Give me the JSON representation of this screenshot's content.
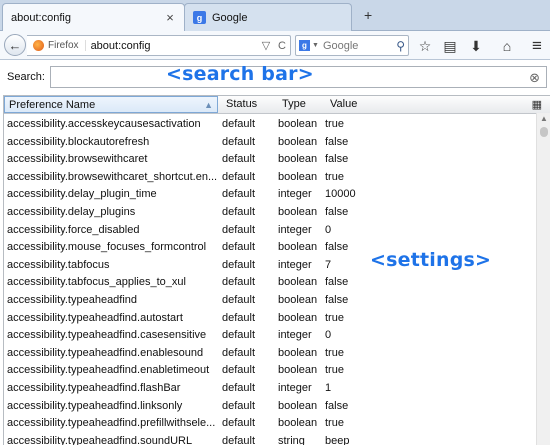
{
  "tabs": [
    {
      "title": "about:config"
    },
    {
      "title": "Google",
      "favicon": "g"
    }
  ],
  "new_tab_icon": "+",
  "navbar": {
    "back_icon": "←",
    "identity_label": "Firefox",
    "url": "about:config",
    "dropdown_icon": "▽",
    "reload_icon": "C",
    "search_engine_icon": "g",
    "search_placeholder": "Google",
    "search_icon": "⚲",
    "star_icon": "☆",
    "bookmarks_icon": "▤",
    "download_icon": "⬇",
    "home_icon": "⌂",
    "menu_icon": "≡"
  },
  "config": {
    "search_label": "Search:",
    "clear_icon": "⊗",
    "columns": {
      "name": "Preference Name",
      "status": "Status",
      "type": "Type",
      "value": "Value"
    },
    "sort_icon": "▲",
    "column_picker_icon": "▦",
    "rows": [
      {
        "name": "accessibility.accesskeycausesactivation",
        "status": "default",
        "type": "boolean",
        "value": "true"
      },
      {
        "name": "accessibility.blockautorefresh",
        "status": "default",
        "type": "boolean",
        "value": "false"
      },
      {
        "name": "accessibility.browsewithcaret",
        "status": "default",
        "type": "boolean",
        "value": "false"
      },
      {
        "name": "accessibility.browsewithcaret_shortcut.en...",
        "status": "default",
        "type": "boolean",
        "value": "true"
      },
      {
        "name": "accessibility.delay_plugin_time",
        "status": "default",
        "type": "integer",
        "value": "10000"
      },
      {
        "name": "accessibility.delay_plugins",
        "status": "default",
        "type": "boolean",
        "value": "false"
      },
      {
        "name": "accessibility.force_disabled",
        "status": "default",
        "type": "integer",
        "value": "0"
      },
      {
        "name": "accessibility.mouse_focuses_formcontrol",
        "status": "default",
        "type": "boolean",
        "value": "false"
      },
      {
        "name": "accessibility.tabfocus",
        "status": "default",
        "type": "integer",
        "value": "7"
      },
      {
        "name": "accessibility.tabfocus_applies_to_xul",
        "status": "default",
        "type": "boolean",
        "value": "false"
      },
      {
        "name": "accessibility.typeaheadfind",
        "status": "default",
        "type": "boolean",
        "value": "false"
      },
      {
        "name": "accessibility.typeaheadfind.autostart",
        "status": "default",
        "type": "boolean",
        "value": "true"
      },
      {
        "name": "accessibility.typeaheadfind.casesensitive",
        "status": "default",
        "type": "integer",
        "value": "0"
      },
      {
        "name": "accessibility.typeaheadfind.enablesound",
        "status": "default",
        "type": "boolean",
        "value": "true"
      },
      {
        "name": "accessibility.typeaheadfind.enabletimeout",
        "status": "default",
        "type": "boolean",
        "value": "true"
      },
      {
        "name": "accessibility.typeaheadfind.flashBar",
        "status": "default",
        "type": "integer",
        "value": "1"
      },
      {
        "name": "accessibility.typeaheadfind.linksonly",
        "status": "default",
        "type": "boolean",
        "value": "false"
      },
      {
        "name": "accessibility.typeaheadfind.prefillwithsele...",
        "status": "default",
        "type": "boolean",
        "value": "true"
      },
      {
        "name": "accessibility.typeaheadfind.soundURL",
        "status": "default",
        "type": "string",
        "value": "beep"
      }
    ]
  },
  "annotations": {
    "search": "<search bar>",
    "settings": "<settings>"
  },
  "colors": {
    "accent": "#1e73e8",
    "tabstrip": "#c9d7e8",
    "header_sorted": "#dbe9f8"
  }
}
